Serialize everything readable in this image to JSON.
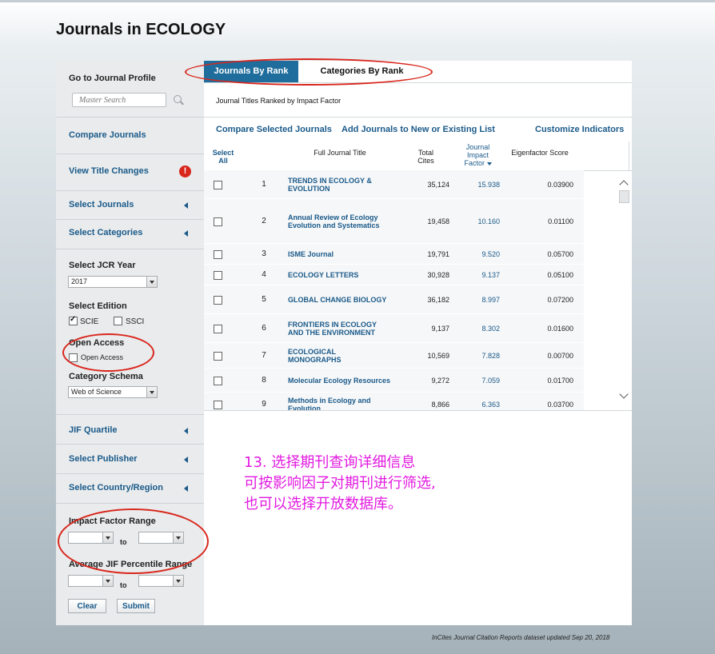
{
  "page": {
    "title": "Journals in ECOLOGY"
  },
  "sidebar": {
    "journal_profile": {
      "label": "Go to Journal Profile",
      "placeholder": "Master Search"
    },
    "compare_journals": "Compare Journals",
    "view_title_changes": "View Title Changes",
    "warn_glyph": "!",
    "select_journals": "Select Journals",
    "select_categories": "Select Categories",
    "jcr_year": {
      "label": "Select JCR Year",
      "value": "2017"
    },
    "edition": {
      "label": "Select Edition",
      "options": [
        {
          "label": "SCIE",
          "checked": true
        },
        {
          "label": "SSCI",
          "checked": false
        }
      ]
    },
    "open_access": {
      "label": "Open Access",
      "option": "Open Access",
      "checked": false
    },
    "category_schema": {
      "label": "Category Schema",
      "value": "Web of Science"
    },
    "jif_quartile": "JIF Quartile",
    "select_publisher": "Select Publisher",
    "select_country": "Select Country/Region",
    "impact_factor_range": {
      "label": "Impact Factor Range",
      "to": "to"
    },
    "jif_percentile_range": {
      "label": "Average JIF Percentile Range",
      "to": "to"
    },
    "clear": "Clear",
    "submit": "Submit"
  },
  "tabs": [
    {
      "label": "Journals By Rank",
      "active": true
    },
    {
      "label": "Categories By Rank",
      "active": false
    }
  ],
  "main": {
    "ranked_title": "Journal Titles Ranked by Impact Factor",
    "toolbar": {
      "compare": "Compare Selected Journals",
      "add_to_list": "Add Journals to New or Existing List",
      "customize": "Customize Indicators"
    },
    "columns": {
      "select_all_1": "Select",
      "select_all_2": "All",
      "title": "Full Journal Title",
      "cites_1": "Total",
      "cites_2": "Cites",
      "jif_1": "Journal",
      "jif_2": "Impact",
      "jif_3": "Factor",
      "eigen": "Eigenfactor Score"
    },
    "rows": [
      {
        "rank": "1",
        "title_1": "TRENDS IN ECOLOGY &",
        "title_2": "EVOLUTION",
        "cites": "35,124",
        "jif": "15.938",
        "eigen": "0.03900"
      },
      {
        "rank": "2",
        "title_1": "Annual Review of Ecology",
        "title_2": "Evolution and Systematics",
        "cites": "19,458",
        "jif": "10.160",
        "eigen": "0.01100"
      },
      {
        "rank": "3",
        "title_1": "ISME Journal",
        "title_2": "",
        "cites": "19,791",
        "jif": "9.520",
        "eigen": "0.05700"
      },
      {
        "rank": "4",
        "title_1": "ECOLOGY LETTERS",
        "title_2": "",
        "cites": "30,928",
        "jif": "9.137",
        "eigen": "0.05100"
      },
      {
        "rank": "5",
        "title_1": "GLOBAL CHANGE BIOLOGY",
        "title_2": "",
        "cites": "36,182",
        "jif": "8.997",
        "eigen": "0.07200"
      },
      {
        "rank": "6",
        "title_1": "FRONTIERS IN ECOLOGY",
        "title_2": "AND THE ENVIRONMENT",
        "cites": "9,137",
        "jif": "8.302",
        "eigen": "0.01600"
      },
      {
        "rank": "7",
        "title_1": "ECOLOGICAL",
        "title_2": "MONOGRAPHS",
        "cites": "10,569",
        "jif": "7.828",
        "eigen": "0.00700"
      },
      {
        "rank": "8",
        "title_1": "Molecular Ecology Resources",
        "title_2": "",
        "cites": "9,272",
        "jif": "7.059",
        "eigen": "0.01700"
      },
      {
        "rank": "9",
        "title_1": "Methods in Ecology and",
        "title_2": "Evolution",
        "cites": "8,866",
        "jif": "6.363",
        "eigen": "0.03700"
      }
    ]
  },
  "annotation": {
    "text": "13. 选择期刊查询详细信息\n可按影响因子对期刊进行筛选,\n也可以选择开放数据库。",
    "color": "#e21be0"
  },
  "footer": "InCites Journal Citation Reports dataset updated Sep 20, 2018",
  "colors": {
    "accent": "#1e6d9c",
    "link": "#1a5a8a",
    "highlight_ellipse": "#d9261c"
  }
}
